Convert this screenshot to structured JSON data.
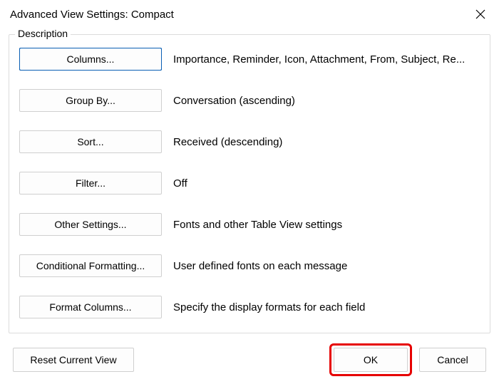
{
  "window": {
    "title": "Advanced View Settings: Compact"
  },
  "groupbox": {
    "label": "Description"
  },
  "rows": [
    {
      "button": "Columns...",
      "desc": "Importance, Reminder, Icon, Attachment, From, Subject, Re...",
      "focused": true
    },
    {
      "button": "Group By...",
      "desc": "Conversation (ascending)",
      "focused": false
    },
    {
      "button": "Sort...",
      "desc": "Received (descending)",
      "focused": false
    },
    {
      "button": "Filter...",
      "desc": "Off",
      "focused": false
    },
    {
      "button": "Other Settings...",
      "desc": "Fonts and other Table View settings",
      "focused": false
    },
    {
      "button": "Conditional Formatting...",
      "desc": "User defined fonts on each message",
      "focused": false
    },
    {
      "button": "Format Columns...",
      "desc": "Specify the display formats for each field",
      "focused": false
    }
  ],
  "footer": {
    "reset": "Reset Current View",
    "ok": "OK",
    "cancel": "Cancel"
  }
}
